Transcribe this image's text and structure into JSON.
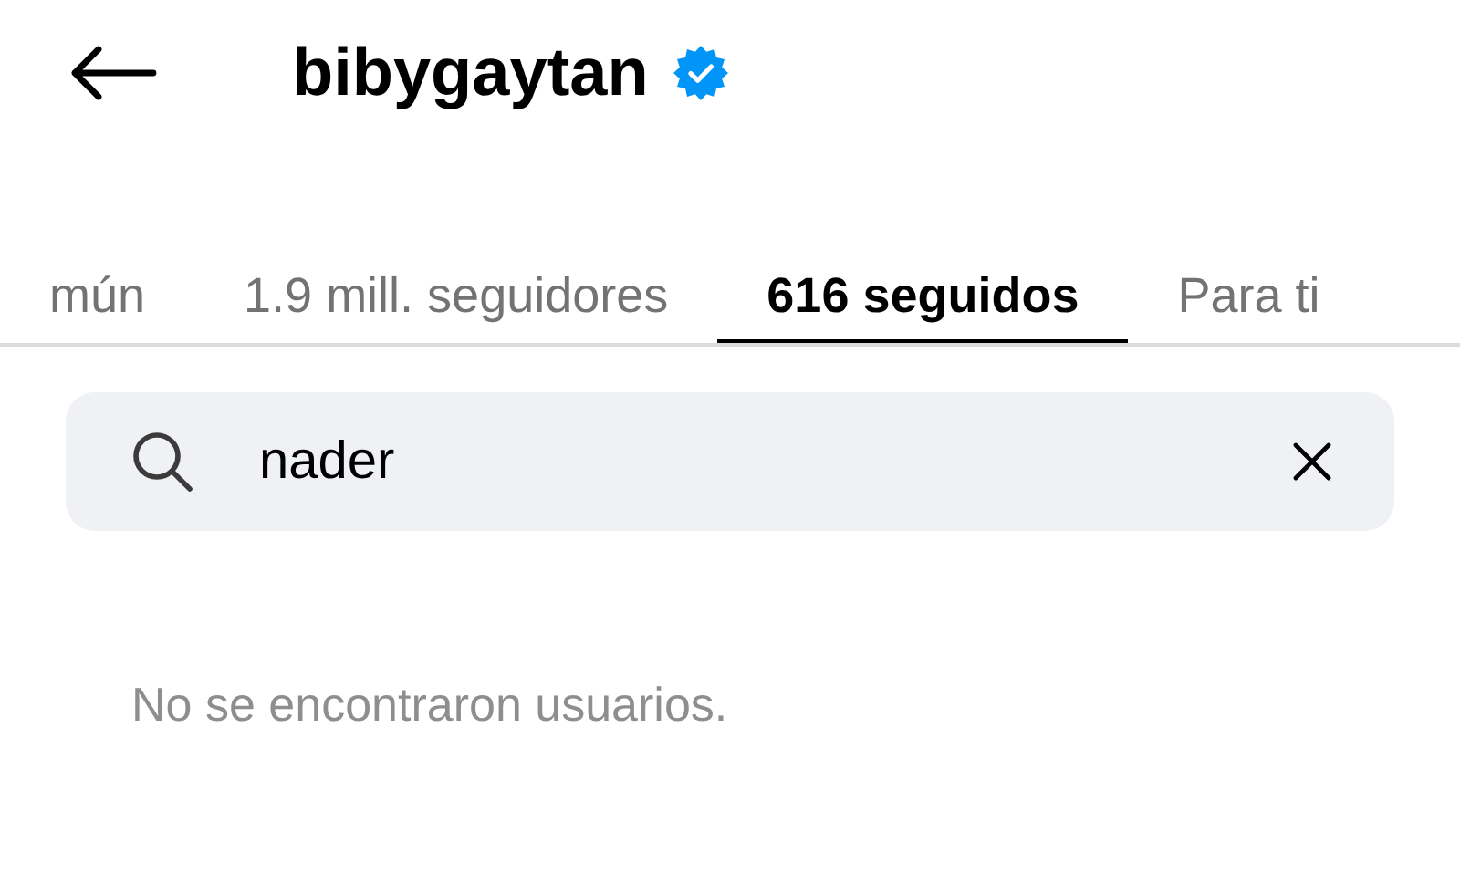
{
  "header": {
    "title": "bibygaytan",
    "verified": true
  },
  "tabs": [
    {
      "label": "mún",
      "selected": false
    },
    {
      "label": "1.9 mill. seguidores",
      "selected": false
    },
    {
      "label": "616 seguidos",
      "selected": true
    },
    {
      "label": "Para ti",
      "selected": false
    }
  ],
  "search": {
    "value": "nader"
  },
  "empty_message": "No se encontraron usuarios."
}
